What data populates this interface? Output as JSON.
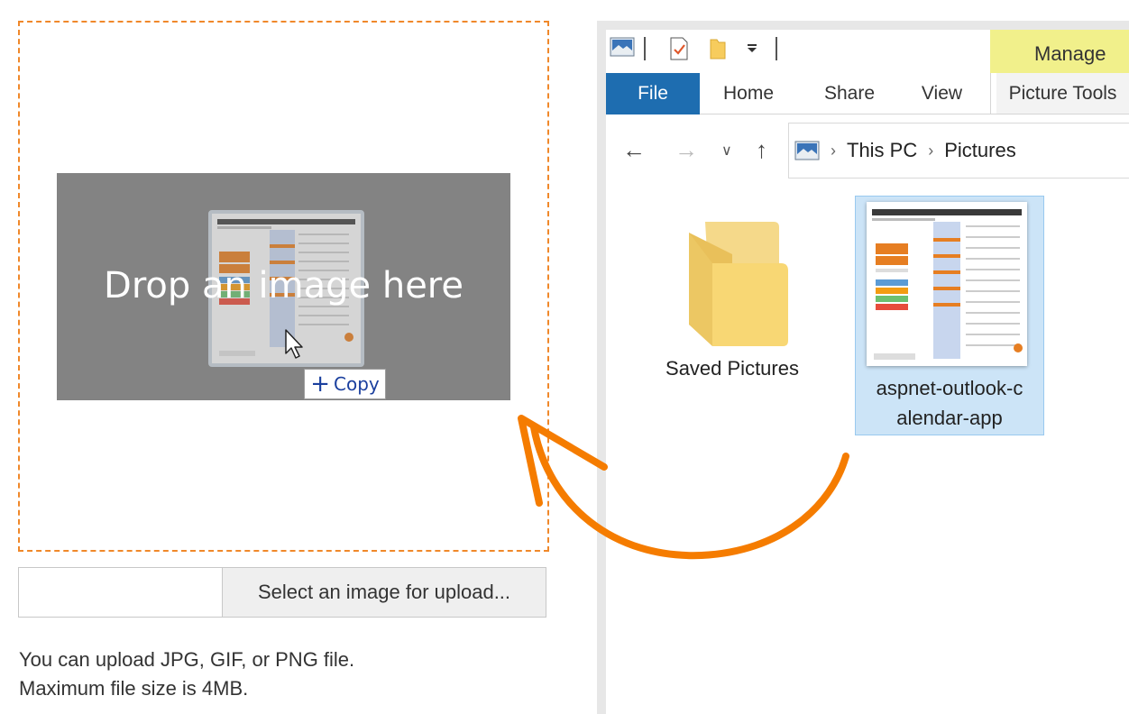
{
  "upload": {
    "drop_text": "Drop an image here",
    "copy_label": "Copy",
    "select_button": "Select an image for upload...",
    "hint_line1": "You can upload JPG, GIF, or PNG file.",
    "hint_line2": "Maximum file size is 4MB."
  },
  "explorer": {
    "contextual_tab": "Manage",
    "tabs": [
      "File",
      "Home",
      "Share",
      "View",
      "Picture Tools"
    ],
    "breadcrumb": [
      "This PC",
      "Pictures"
    ],
    "items": [
      {
        "label": "Saved Pictures",
        "icon": "folder-icon"
      },
      {
        "label_line1": "aspnet-outlook-c",
        "label_line2": "alendar-app",
        "icon": "image-thumbnail"
      }
    ]
  },
  "colors": {
    "accent_orange": "#f0882a",
    "file_tab_blue": "#1e6db0",
    "manage_yellow": "#f1f08b",
    "selection_blue": "#cce4f7"
  }
}
